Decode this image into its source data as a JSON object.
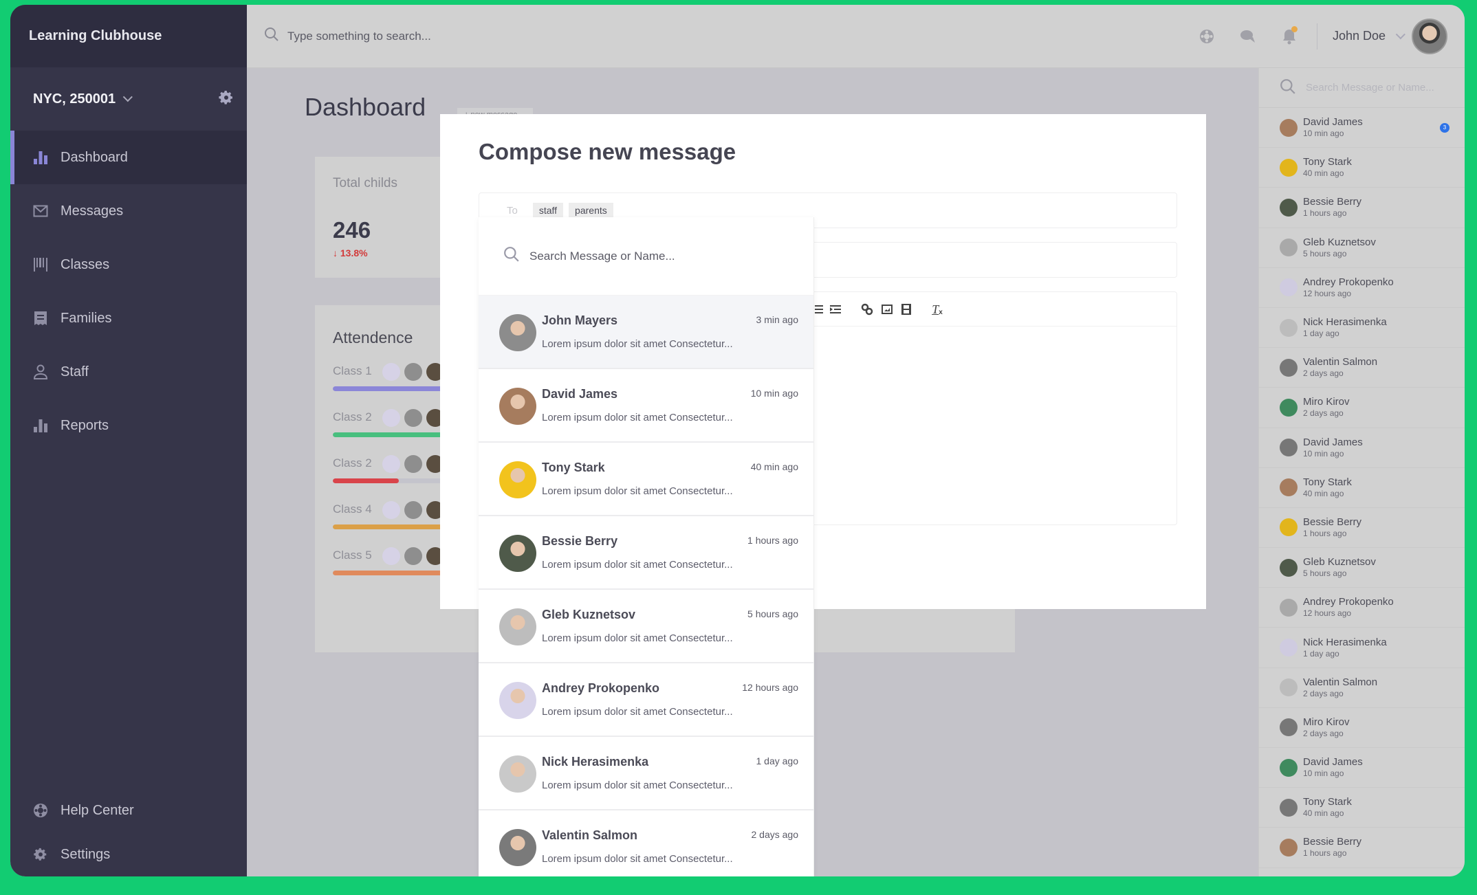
{
  "app": {
    "title": "Learning Clubhouse",
    "location": "NYC, 250001"
  },
  "colors": {
    "accent": "#8a86d6",
    "background_frame": "#12cc72",
    "danger": "#d23a3a",
    "badge": "#2e73e8",
    "notification_dot": "#e8a94a"
  },
  "sidebar": {
    "items": [
      {
        "label": "Dashboard",
        "icon": "bar-chart-icon",
        "active": true
      },
      {
        "label": "Messages",
        "icon": "envelope-icon",
        "active": false
      },
      {
        "label": "Classes",
        "icon": "barcode-icon",
        "active": false
      },
      {
        "label": "Families",
        "icon": "receipt-icon",
        "active": false
      },
      {
        "label": "Staff",
        "icon": "person-icon",
        "active": false
      },
      {
        "label": "Reports",
        "icon": "bar-chart-icon",
        "active": false
      }
    ],
    "bottom": [
      {
        "label": "Help Center",
        "icon": "lifebuoy-icon"
      },
      {
        "label": "Settings",
        "icon": "gear-icon"
      }
    ]
  },
  "topbar": {
    "search_placeholder": "Type something to search...",
    "user_name": "John Doe"
  },
  "dashboard": {
    "title": "Dashboard",
    "new_message_button": "+ new message",
    "total": {
      "label": "Total childs",
      "value": "246",
      "delta": "13.8%",
      "delta_direction": "down"
    },
    "attendance": {
      "title": "Attendence",
      "classes": [
        {
          "label": "Class 1",
          "color": "#8b86d8",
          "progress": 1.0
        },
        {
          "label": "Class 2",
          "color": "#48bf7e",
          "progress": 1.0
        },
        {
          "label": "Class 2",
          "color": "#d9444a",
          "progress": 0.24
        },
        {
          "label": "Class 4",
          "color": "#dba048",
          "progress": 1.0
        },
        {
          "label": "Class 5",
          "color": "#e08a5c",
          "progress": 1.0
        }
      ]
    }
  },
  "modal": {
    "title": "Compose new message",
    "to_label": "To",
    "recipients": [
      "staff",
      "parents"
    ],
    "toolbar": [
      "bullet-list",
      "indent",
      "link",
      "image",
      "video",
      "clear-format"
    ]
  },
  "dropdown": {
    "search_placeholder": "Search Message or Name...",
    "items": [
      {
        "name": "John Mayers",
        "time": "3 min ago",
        "snippet": "Lorem ipsum dolor sit amet Consectetur...",
        "avatar_color": "#8c8c8c"
      },
      {
        "name": "David James",
        "time": "10 min ago",
        "snippet": "Lorem ipsum dolor sit amet Consectetur...",
        "avatar_color": "#a67c5e"
      },
      {
        "name": "Tony Stark",
        "time": "40 min ago",
        "snippet": "Lorem ipsum dolor sit amet Consectetur...",
        "avatar_color": "#f2c31d"
      },
      {
        "name": "Bessie Berry",
        "time": "1 hours ago",
        "snippet": "Lorem ipsum dolor sit amet Consectetur...",
        "avatar_color": "#4f5a4a"
      },
      {
        "name": "Gleb Kuznetsov",
        "time": "5 hours ago",
        "snippet": "Lorem ipsum dolor sit amet Consectetur...",
        "avatar_color": "#bdbdbd"
      },
      {
        "name": "Andrey Prokopenko",
        "time": "12 hours ago",
        "snippet": "Lorem ipsum dolor sit amet Consectetur...",
        "avatar_color": "#d8d4ea"
      },
      {
        "name": "Nick Herasimenka",
        "time": "1 day ago",
        "snippet": "Lorem ipsum dolor sit amet Consectetur...",
        "avatar_color": "#c9c9c9"
      },
      {
        "name": "Valentin Salmon",
        "time": "2 days ago",
        "snippet": "Lorem ipsum dolor sit amet Consectetur...",
        "avatar_color": "#7a7a7a"
      }
    ]
  },
  "right_panel": {
    "search_placeholder": "Search Message or Name...",
    "contacts": [
      {
        "name": "David James",
        "time": "10 min ago",
        "badge": "3",
        "avatar_color": "#a67c5e"
      },
      {
        "name": "Tony Stark",
        "time": "40 min ago",
        "avatar_color": "#e2b51c"
      },
      {
        "name": "Bessie Berry",
        "time": "1 hours ago",
        "avatar_color": "#4f5a4a"
      },
      {
        "name": "Gleb Kuznetsov",
        "time": "5 hours ago",
        "avatar_color": "#a9a9a9"
      },
      {
        "name": "Andrey Prokopenko",
        "time": "12 hours ago",
        "avatar_color": "#cfcbe0"
      },
      {
        "name": "Nick Herasimenka",
        "time": "1 day ago",
        "avatar_color": "#bcbcbc"
      },
      {
        "name": "Valentin Salmon",
        "time": "2 days ago",
        "avatar_color": "#777777"
      },
      {
        "name": "Miro Kirov",
        "time": "2 days ago",
        "avatar_color": "#3f8a5e"
      },
      {
        "name": "David James",
        "time": "10 min ago",
        "avatar_color": "#777777"
      },
      {
        "name": "Tony Stark",
        "time": "40 min ago",
        "avatar_color": "#a67c5e"
      },
      {
        "name": "Bessie Berry",
        "time": "1 hours ago",
        "avatar_color": "#e2b51c"
      },
      {
        "name": "Gleb Kuznetsov",
        "time": "5 hours ago",
        "avatar_color": "#4f5a4a"
      },
      {
        "name": "Andrey Prokopenko",
        "time": "12 hours ago",
        "avatar_color": "#a9a9a9"
      },
      {
        "name": "Nick Herasimenka",
        "time": "1 day ago",
        "avatar_color": "#cfcbe0"
      },
      {
        "name": "Valentin Salmon",
        "time": "2 days ago",
        "avatar_color": "#bcbcbc"
      },
      {
        "name": "Miro Kirov",
        "time": "2 days ago",
        "avatar_color": "#777777"
      },
      {
        "name": "David James",
        "time": "10 min ago",
        "avatar_color": "#3f8a5e"
      },
      {
        "name": "Tony Stark",
        "time": "40 min ago",
        "avatar_color": "#777777"
      },
      {
        "name": "Bessie Berry",
        "time": "1 hours ago",
        "avatar_color": "#a67c5e"
      }
    ]
  }
}
